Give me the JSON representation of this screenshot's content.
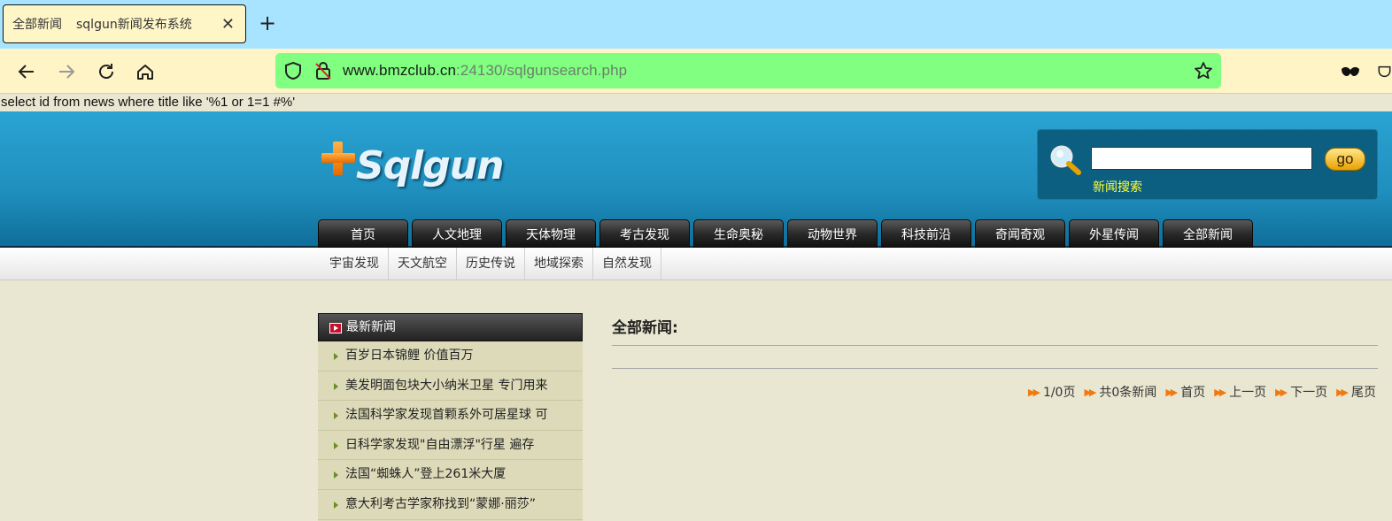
{
  "browser": {
    "tab_title": "全部新闻",
    "tab_subtitle": "sqlgun新闻发布系统",
    "url_host": "www.bmzclub.cn",
    "url_rest": ":24130/sqlgunsearch.php"
  },
  "sql_debug": "select id from news where title like '%1 or 1=1 #%'",
  "header": {
    "logo_text": "Sqlgun",
    "search_placeholder": "",
    "search_button": "go",
    "search_label": "新闻搜索"
  },
  "main_nav": [
    "首页",
    "人文地理",
    "天体物理",
    "考古发现",
    "生命奥秘",
    "动物世界",
    "科技前沿",
    "奇闻奇观",
    "外星传闻",
    "全部新闻"
  ],
  "sub_nav": [
    "宇宙发现",
    "天文航空",
    "历史传说",
    "地域探索",
    "自然发现"
  ],
  "sidebar": {
    "title": "最新新闻",
    "items": [
      "百岁日本锦鲤 价值百万",
      "美发明面包块大小纳米卫星 专门用来",
      "法国科学家发现首颗系外可居星球 可",
      "日科学家发现\"自由漂浮\"行星 遍存",
      "法国“蜘蛛人”登上261米大厦",
      "意大利考古学家称找到“蒙娜·丽莎”"
    ]
  },
  "content": {
    "title": "全部新闻:",
    "pager": {
      "page_info": "1/0页",
      "total": "共0条新闻",
      "first": "首页",
      "prev": "上一页",
      "next": "下一页",
      "last": "尾页"
    }
  },
  "colors": {
    "tabbar": "#a8e4ff",
    "navbar": "#fff4c6",
    "urlbar": "#80ff80",
    "page_bg": "#e9e7d1",
    "header_blue": "#1f8fbd",
    "search_label": "#ffff33",
    "pager_arrow": "#f07a10"
  }
}
